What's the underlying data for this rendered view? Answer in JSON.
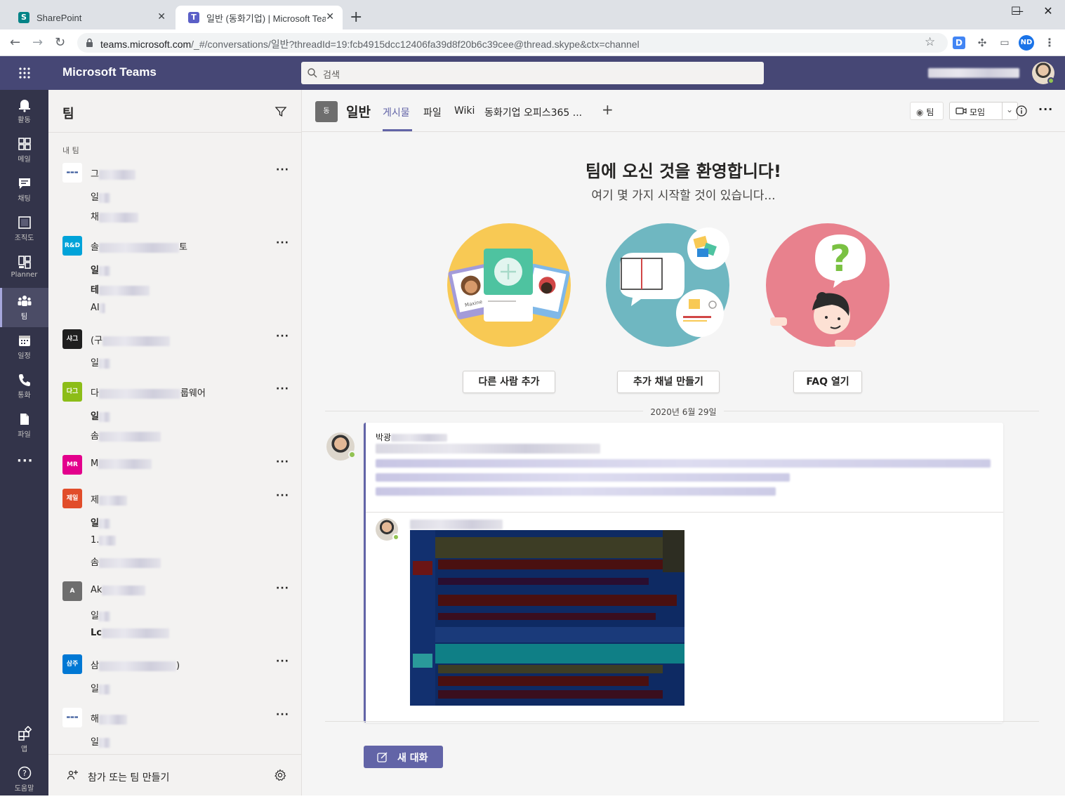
{
  "browser": {
    "tabs": [
      {
        "title": "SharePoint"
      },
      {
        "title": "일반 (동화기업) | Microsoft Teams"
      }
    ],
    "url_host": "teams.microsoft.com",
    "url_path": "/_#/conversations/일반?threadId=19:fcb4915dcc12406fa39d8f20b6c39cee@thread.skype&ctx=channel",
    "profile_initials": "ND",
    "ext_d": "D"
  },
  "teams_header": {
    "app_name": "Microsoft Teams",
    "search_placeholder": "검색"
  },
  "rail": {
    "items": [
      {
        "label": "활동",
        "icon": "bell-icon"
      },
      {
        "label": "메일",
        "icon": "mail-icon"
      },
      {
        "label": "채팅",
        "icon": "chat-icon"
      },
      {
        "label": "조직도",
        "icon": "org-chart-icon"
      },
      {
        "label": "Planner",
        "icon": "planner-icon"
      },
      {
        "label": "팀",
        "icon": "teams-icon"
      },
      {
        "label": "일정",
        "icon": "calendar-icon"
      },
      {
        "label": "통화",
        "icon": "phone-icon"
      },
      {
        "label": "파일",
        "icon": "file-icon"
      }
    ],
    "apps_label": "앱",
    "help_label": "도움말"
  },
  "team_list": {
    "title": "팀",
    "section_label": "내 팀",
    "teams": [
      {
        "name": "그",
        "avatar": "",
        "avatar_color": "#ffffff",
        "channels": [
          "일",
          "채"
        ]
      },
      {
        "name": "솔",
        "name_end": "토",
        "avatar": "R&D",
        "avatar_color": "#00a3d9",
        "channels": [
          "일",
          "테",
          "AI"
        ]
      },
      {
        "name": "(구",
        "avatar": "샤그",
        "avatar_color": "#1f1f1f",
        "channels": [
          "일"
        ]
      },
      {
        "name": "다",
        "name_end": "룹웨어",
        "avatar": "다그",
        "avatar_color": "#8cbd18",
        "channels": [
          "일",
          "솜"
        ]
      },
      {
        "name": "M",
        "avatar": "MR",
        "avatar_color": "#e3008c",
        "channels": []
      },
      {
        "name": "제",
        "avatar": "제일",
        "avatar_color": "#e14d2a",
        "channels": [
          "일",
          "1.",
          "솜"
        ]
      },
      {
        "name": "Ak",
        "avatar": "A",
        "avatar_color": "#6e6e6e",
        "channels": [
          "일",
          "Lc"
        ]
      },
      {
        "name": "삼",
        "name_end": ")",
        "avatar": "삼주",
        "avatar_color": "#0078d4",
        "channels": [
          "일"
        ]
      },
      {
        "name": "해",
        "avatar": "",
        "avatar_color": "#ffffff",
        "channels": [
          "일"
        ]
      }
    ],
    "join_label": "참가 또는 팀 만들기"
  },
  "channel": {
    "avatar": "동",
    "name": "일반",
    "tabs": [
      "게시물",
      "파일",
      "Wiki",
      "동화기업 오피스365 ..."
    ],
    "team_button": "팀",
    "meet_button": "모임"
  },
  "welcome": {
    "title": "팀에 오신 것을 환영합니다!",
    "subtitle": "여기 몇 가지 시작할 것이 있습니다...",
    "actions": [
      "다른 사람 추가",
      "추가 채널 만들기",
      "FAQ 열기"
    ],
    "illustration_names": [
      "Maxine"
    ]
  },
  "conversation": {
    "date": "2020년 6월 29일",
    "author": "박광",
    "new_conversation": "새 대화"
  },
  "colors": {
    "teams_purple": "#6264a7",
    "header_bg": "#464775",
    "rail_bg": "#33344a"
  }
}
